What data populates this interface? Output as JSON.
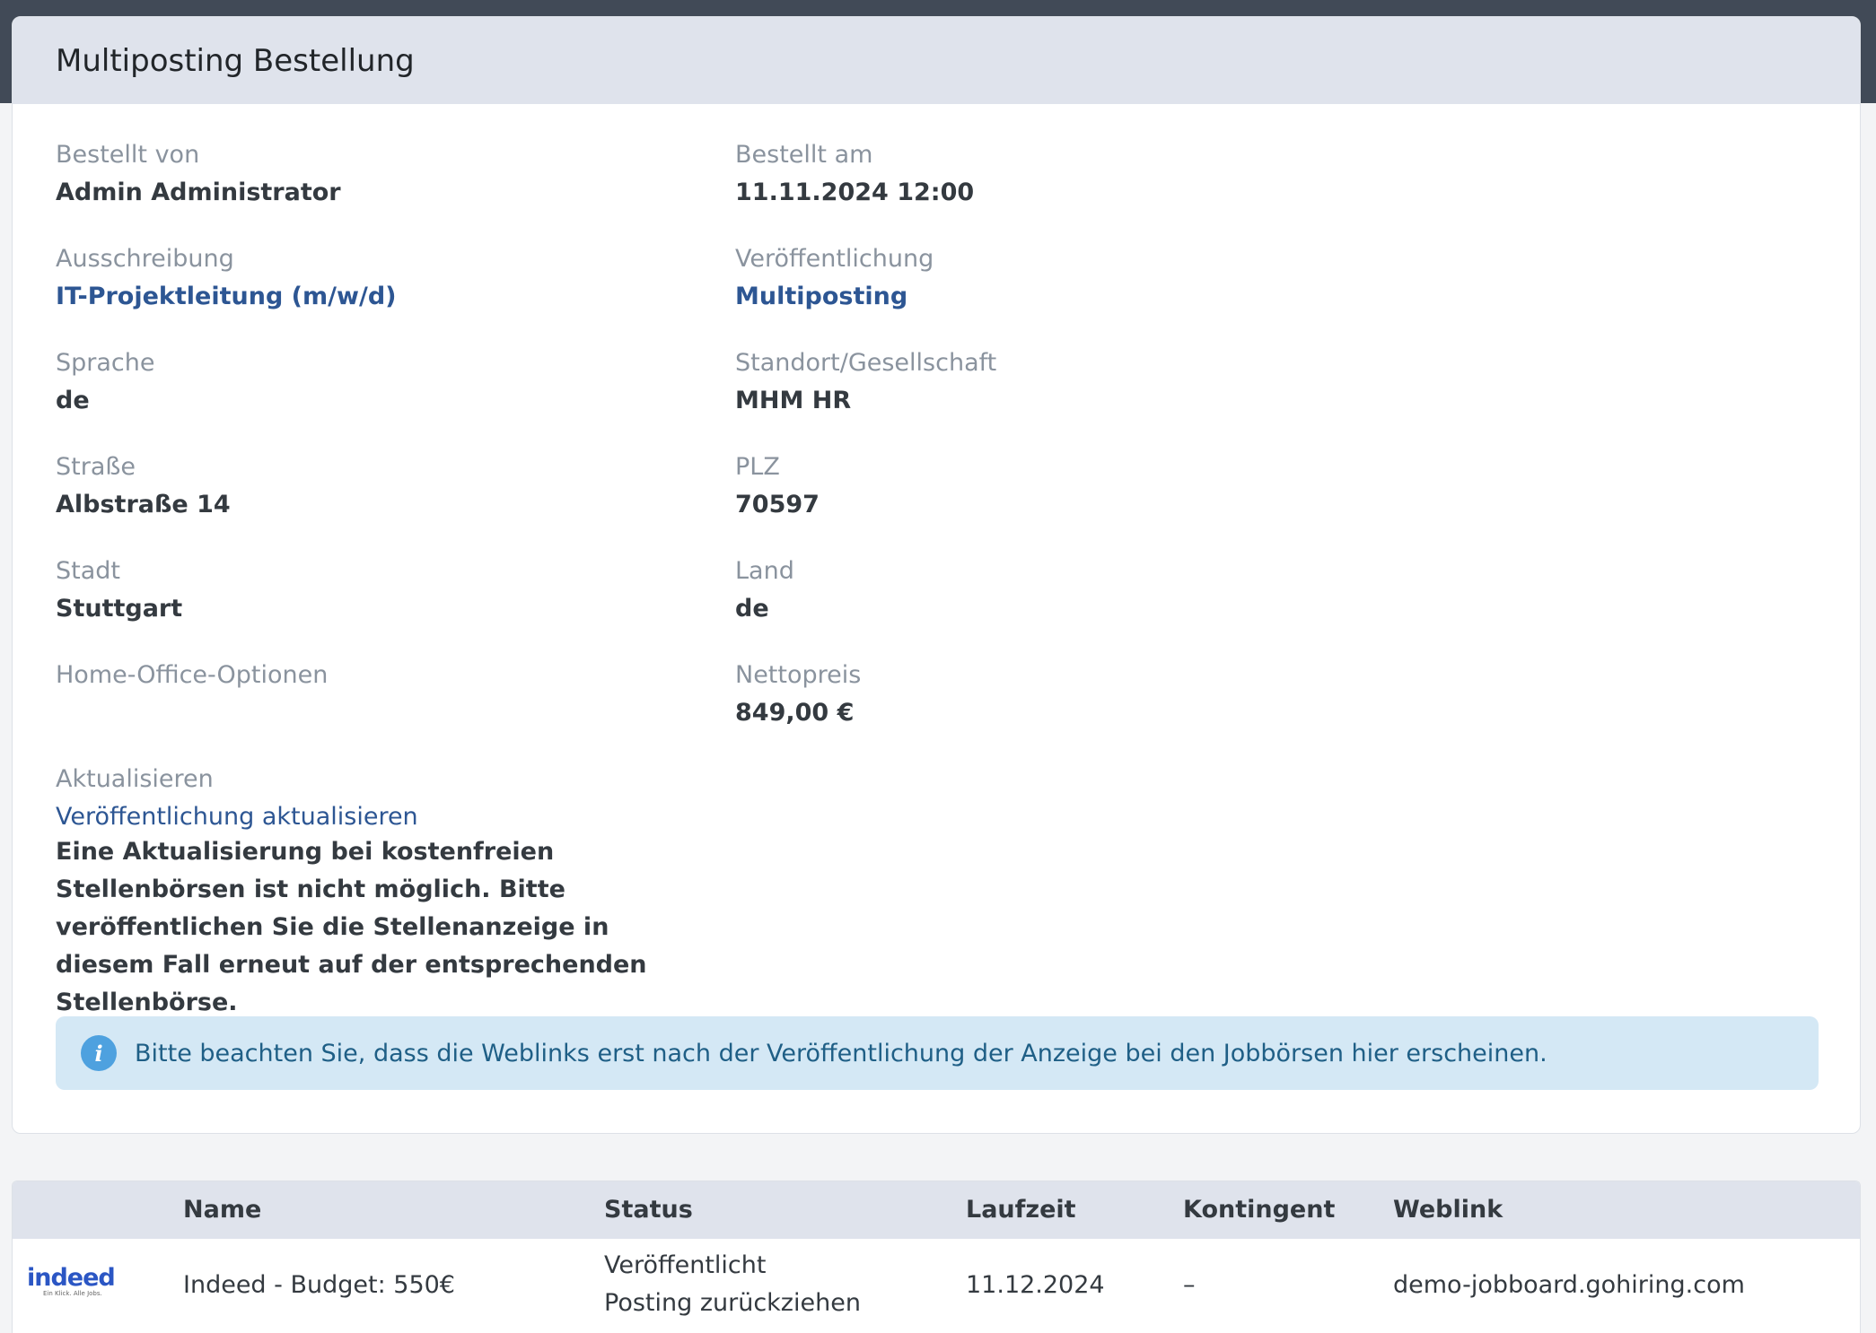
{
  "card": {
    "title": "Multiposting Bestellung",
    "fields": {
      "ordered_by": {
        "label": "Bestellt von",
        "value": "Admin Administrator"
      },
      "ordered_at": {
        "label": "Bestellt am",
        "value": "11.11.2024 12:00"
      },
      "tender": {
        "label": "Ausschreibung",
        "value": "IT-Projektleitung (m/w/d)"
      },
      "publication": {
        "label": "Veröffentlichung",
        "value": "Multiposting"
      },
      "language": {
        "label": "Sprache",
        "value": "de"
      },
      "location": {
        "label": "Standort/Gesellschaft",
        "value": "MHM HR"
      },
      "street": {
        "label": "Straße",
        "value": "Albstraße 14"
      },
      "zip": {
        "label": "PLZ",
        "value": "70597"
      },
      "city": {
        "label": "Stadt",
        "value": "Stuttgart"
      },
      "country": {
        "label": "Land",
        "value": "de"
      },
      "home_office": {
        "label": "Home-Office-Optionen",
        "value": ""
      },
      "net_price": {
        "label": "Nettopreis",
        "value": "849,00 €"
      },
      "update": {
        "label": "Aktualisieren",
        "link": "Veröffentlichung aktualisieren",
        "description": "Eine Aktualisierung bei kostenfreien Stellenbörsen ist nicht möglich. Bitte veröffentlichen Sie die Stellenanzeige in diesem Fall erneut auf der entsprechenden Stellenbörse."
      }
    },
    "alert": {
      "icon": "info-icon",
      "text": "Bitte beachten Sie, dass die Weblinks erst nach der Veröffentlichung der Anzeige bei den Jobbörsen hier erscheinen."
    }
  },
  "table": {
    "headers": [
      "Name",
      "Status",
      "Laufzeit",
      "Kontingent",
      "Weblink"
    ],
    "rows": [
      {
        "logo": {
          "word": "indeed",
          "tagline": "Ein Klick. Alle Jobs."
        },
        "name": "Indeed - Budget: 550€",
        "status": "Veröffentlicht",
        "status_action": "Posting zurückziehen",
        "runtime": "11.12.2024",
        "quota": "–",
        "weblink": "demo-jobboard.gohiring.com"
      }
    ]
  },
  "colors": {
    "topbar": "#414a57",
    "header_bg": "#dfe3ec",
    "link": "#2d5693",
    "alert_bg": "#d4e8f5",
    "alert_text": "#1f5f86",
    "info_icon": "#4ea1df"
  }
}
